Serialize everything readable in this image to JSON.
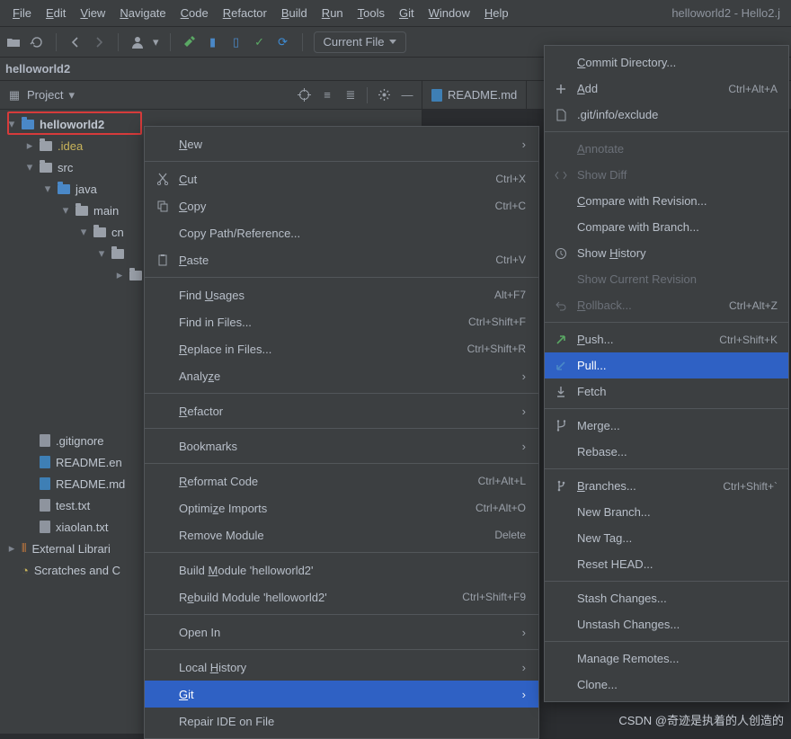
{
  "window_title": "helloworld2 - Hello2.j",
  "menubar": [
    "File",
    "Edit",
    "View",
    "Navigate",
    "Code",
    "Refactor",
    "Build",
    "Run",
    "Tools",
    "Git",
    "Window",
    "Help"
  ],
  "menubar_mn": [
    "F",
    "E",
    "V",
    "N",
    "C",
    "R",
    "B",
    "R",
    "T",
    "G",
    "W",
    "H"
  ],
  "current_file_label": "Current File",
  "breadcrumb": "helloworld2",
  "sidebar": {
    "dropdown": "Project"
  },
  "tree": {
    "root": "helloworld2",
    "idea": ".idea",
    "src": "src",
    "java": "java",
    "main": "main",
    "cn": "cn",
    "gitignore": ".gitignore",
    "readme_en": "README.en",
    "readme_md": "README.md",
    "test_txt": "test.txt",
    "xiaolan_txt": "xiaolan.txt",
    "ext_lib": "External Librari",
    "scratches": "Scratches and C"
  },
  "editor_tab": "README.md",
  "ctx": [
    {
      "type": "item",
      "label": "New",
      "mn": "N",
      "arrow": true
    },
    {
      "type": "sep"
    },
    {
      "type": "item",
      "icon": "cut",
      "label": "Cut",
      "mn": "C",
      "shortcut": "Ctrl+X"
    },
    {
      "type": "item",
      "icon": "copy",
      "label": "Copy",
      "mn": "C",
      "shortcut": "Ctrl+C"
    },
    {
      "type": "item",
      "label": "Copy Path/Reference..."
    },
    {
      "type": "item",
      "icon": "paste",
      "label": "Paste",
      "mn": "P",
      "shortcut": "Ctrl+V"
    },
    {
      "type": "sep"
    },
    {
      "type": "item",
      "label": "Find Usages",
      "mn": "U",
      "shortcut": "Alt+F7"
    },
    {
      "type": "item",
      "label": "Find in Files...",
      "shortcut": "Ctrl+Shift+F"
    },
    {
      "type": "item",
      "label": "Replace in Files...",
      "mn": "R",
      "shortcut": "Ctrl+Shift+R"
    },
    {
      "type": "item",
      "label": "Analyze",
      "mn": "z",
      "arrow": true
    },
    {
      "type": "sep"
    },
    {
      "type": "item",
      "label": "Refactor",
      "mn": "R",
      "arrow": true
    },
    {
      "type": "sep"
    },
    {
      "type": "item",
      "label": "Bookmarks",
      "arrow": true
    },
    {
      "type": "sep"
    },
    {
      "type": "item",
      "label": "Reformat Code",
      "mn": "R",
      "shortcut": "Ctrl+Alt+L"
    },
    {
      "type": "item",
      "label": "Optimize Imports",
      "mn": "z",
      "shortcut": "Ctrl+Alt+O"
    },
    {
      "type": "item",
      "label": "Remove Module",
      "shortcut": "Delete"
    },
    {
      "type": "sep"
    },
    {
      "type": "item",
      "label": "Build Module 'helloworld2'",
      "mn": "M"
    },
    {
      "type": "item",
      "label": "Rebuild Module 'helloworld2'",
      "mn": "e",
      "shortcut": "Ctrl+Shift+F9"
    },
    {
      "type": "sep"
    },
    {
      "type": "item",
      "label": "Open In",
      "arrow": true
    },
    {
      "type": "sep"
    },
    {
      "type": "item",
      "label": "Local History",
      "mn": "H",
      "arrow": true
    },
    {
      "type": "item",
      "label": "Git",
      "mn": "G",
      "arrow": true,
      "selected": true
    },
    {
      "type": "item",
      "label": "Repair IDE on File"
    }
  ],
  "git": [
    {
      "type": "item",
      "label": "Commit Directory...",
      "mn": "C"
    },
    {
      "type": "item",
      "icon": "plus",
      "label": "Add",
      "mn": "A",
      "shortcut": "Ctrl+Alt+A"
    },
    {
      "type": "item",
      "icon": "file",
      "label": ".git/info/exclude"
    },
    {
      "type": "sep"
    },
    {
      "type": "item",
      "label": "Annotate",
      "mn": "A",
      "disabled": true
    },
    {
      "type": "item",
      "icon": "diff",
      "label": "Show Diff",
      "disabled": true
    },
    {
      "type": "item",
      "label": "Compare with Revision...",
      "mn": "C"
    },
    {
      "type": "item",
      "label": "Compare with Branch..."
    },
    {
      "type": "item",
      "icon": "clock",
      "label": "Show History",
      "mn": "H"
    },
    {
      "type": "item",
      "label": "Show Current Revision",
      "disabled": true
    },
    {
      "type": "item",
      "icon": "rollback",
      "label": "Rollback...",
      "mn": "R",
      "shortcut": "Ctrl+Alt+Z",
      "disabled": true
    },
    {
      "type": "sep"
    },
    {
      "type": "item",
      "icon": "push",
      "label": "Push...",
      "mn": "P",
      "shortcut": "Ctrl+Shift+K"
    },
    {
      "type": "item",
      "icon": "pull",
      "label": "Pull...",
      "selected": true
    },
    {
      "type": "item",
      "icon": "fetch",
      "label": "Fetch"
    },
    {
      "type": "sep"
    },
    {
      "type": "item",
      "icon": "merge",
      "label": "Merge..."
    },
    {
      "type": "item",
      "label": "Rebase..."
    },
    {
      "type": "sep"
    },
    {
      "type": "item",
      "icon": "branch",
      "label": "Branches...",
      "mn": "B",
      "shortcut": "Ctrl+Shift+`"
    },
    {
      "type": "item",
      "label": "New Branch..."
    },
    {
      "type": "item",
      "label": "New Tag..."
    },
    {
      "type": "item",
      "label": "Reset HEAD..."
    },
    {
      "type": "sep"
    },
    {
      "type": "item",
      "label": "Stash Changes..."
    },
    {
      "type": "item",
      "label": "Unstash Changes..."
    },
    {
      "type": "sep"
    },
    {
      "type": "item",
      "label": "Manage Remotes..."
    },
    {
      "type": "item",
      "label": "Clone..."
    }
  ],
  "watermark": "CSDN @奇迹是执着的人创造的"
}
